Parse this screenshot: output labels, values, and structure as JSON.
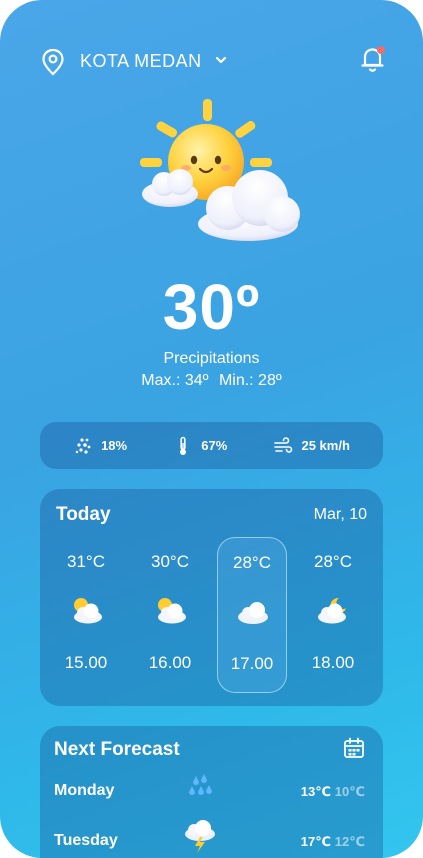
{
  "header": {
    "location": "KOTA MEDAN",
    "icons": [
      "location-pin-icon",
      "chevron-down-icon",
      "notification-bell-icon"
    ],
    "notification_dot_color": "#f26b6b"
  },
  "current": {
    "illustration": "sun-behind-clouds",
    "temperature": "30º",
    "description": "Precipitations",
    "max": "Max.: 34º",
    "min": "Min.: 28º"
  },
  "stats": [
    {
      "icon": "rain-drops-icon",
      "value": "18%"
    },
    {
      "icon": "thermometer-icon",
      "value": "67%"
    },
    {
      "icon": "wind-icon",
      "value": "25 km/h"
    }
  ],
  "today": {
    "title": "Today",
    "date": "Mar, 10",
    "hours": [
      {
        "temp": "31°C",
        "icon": "partly-cloudy-icon",
        "time": "15.00",
        "active": false
      },
      {
        "temp": "30°C",
        "icon": "partly-cloudy-icon",
        "time": "16.00",
        "active": false
      },
      {
        "temp": "28°C",
        "icon": "cloud-icon",
        "time": "17.00",
        "active": true
      },
      {
        "temp": "28°C",
        "icon": "moon-cloud-icon",
        "time": "18.00",
        "active": false
      }
    ]
  },
  "next_forecast": {
    "title": "Next Forecast",
    "icon": "calendar-icon",
    "days": [
      {
        "day": "Monday",
        "icon": "rain-icon",
        "high": "13℃",
        "low": "10℃"
      },
      {
        "day": "Tuesday",
        "icon": "thunderstorm-icon",
        "high": "17℃",
        "low": "12℃"
      }
    ]
  },
  "colors": {
    "background_top": "#4aa6e8",
    "background_bottom": "#33c6ee",
    "card": "rgba(16,64,132,0.30)",
    "sun": "#ffc93a"
  }
}
